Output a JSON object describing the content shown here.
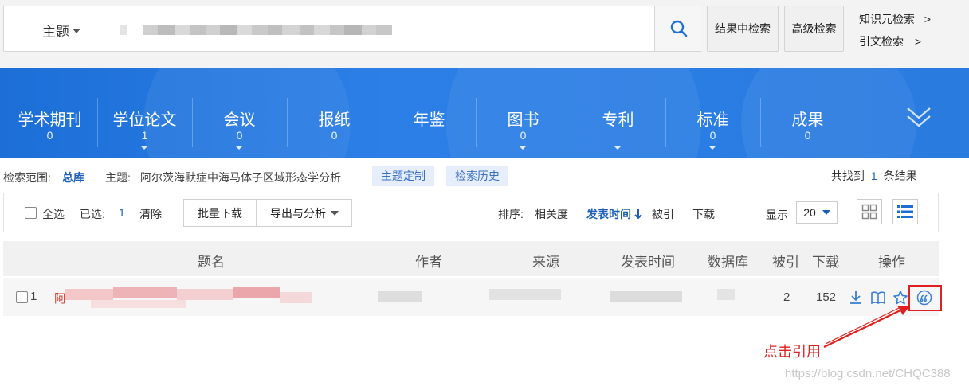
{
  "search": {
    "field_type": "主题",
    "placeholder": ""
  },
  "top_buttons": {
    "search_in_results": "结果中检索",
    "advanced_search": "高级检索",
    "knowledge_search": "知识元检索",
    "citation_search": "引文检索",
    "link_arrow": ">"
  },
  "categories": [
    {
      "name": "学术期刊",
      "count": "0",
      "has_dropdown": false
    },
    {
      "name": "学位论文",
      "count": "1",
      "has_dropdown": true
    },
    {
      "name": "会议",
      "count": "0",
      "has_dropdown": true
    },
    {
      "name": "报纸",
      "count": "0",
      "has_dropdown": false
    },
    {
      "name": "年鉴",
      "count": "",
      "has_dropdown": false
    },
    {
      "name": "图书",
      "count": "0",
      "has_dropdown": true
    },
    {
      "name": "专利",
      "count": "",
      "has_dropdown": true
    },
    {
      "name": "标准",
      "count": "0",
      "has_dropdown": true
    },
    {
      "name": "成果",
      "count": "0",
      "has_dropdown": false
    }
  ],
  "scope": {
    "label": "检索范围:",
    "scope_value": "总库",
    "topic_label": "主题:",
    "topic_value": "阿尔茨海默症中海马体子区域形态学分析",
    "topic_custom": "主题定制",
    "search_history": "检索历史",
    "found_prefix": "共找到",
    "found_count": "1",
    "found_suffix": "条结果"
  },
  "toolbar": {
    "select_all": "全选",
    "selected_label": "已选:",
    "selected_count": "1",
    "clear": "清除",
    "batch_download": "批量下载",
    "export_analysis": "导出与分析",
    "sort_label": "排序:",
    "sort_relevance": "相关度",
    "sort_date": "发表时间",
    "sort_cited": "被引",
    "sort_download": "下载",
    "display_label": "显示",
    "page_size": "20"
  },
  "table": {
    "headers": [
      "题名",
      "作者",
      "来源",
      "发表时间",
      "数据库",
      "被引",
      "下载",
      "操作"
    ],
    "rows": [
      {
        "index": "1",
        "title_first_char": "阿",
        "cited": "2",
        "downloads": "152"
      }
    ]
  },
  "annotation": {
    "text": "点击引用",
    "color": "#e02020"
  },
  "watermark": "https://blog.csdn.net/CHQC388",
  "colors": {
    "accent_blue": "#2a7be0",
    "link_blue": "#1d5fb8"
  }
}
